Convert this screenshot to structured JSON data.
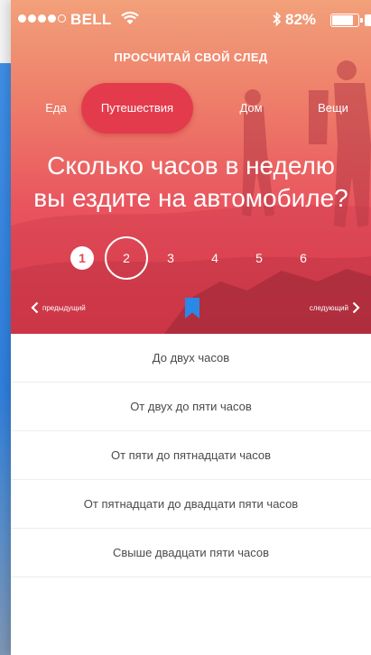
{
  "status": {
    "carrier": "BELL",
    "battery": "82%",
    "battery_level": 0.82
  },
  "header": {
    "title": "ПРОСЧИТАЙ СВОЙ СЛЕД"
  },
  "tabs": [
    {
      "label": "Еда",
      "active": false
    },
    {
      "label": "Путешествия",
      "active": true
    },
    {
      "label": "Дом",
      "active": false
    },
    {
      "label": "Вещи",
      "active": false
    }
  ],
  "question": {
    "line1": "Сколько часов в неделю",
    "line2": "вы ездите на автомобиле?"
  },
  "steps": [
    {
      "label": "1",
      "state": "done"
    },
    {
      "label": "2",
      "state": "current"
    },
    {
      "label": "3",
      "state": "upcoming"
    },
    {
      "label": "4",
      "state": "upcoming"
    },
    {
      "label": "5",
      "state": "upcoming"
    },
    {
      "label": "6",
      "state": "upcoming"
    }
  ],
  "nav": {
    "prev_label": "предыдущий",
    "next_label": "следующий"
  },
  "answers": [
    "До двух часов",
    "От двух до пяти часов",
    "От пяти до пятнадцати часов",
    "От пятнадцати до двадцати пяти часов",
    "Свыше двадцати пяти часов"
  ],
  "colors": {
    "accent": "#e43b4c",
    "bookmark": "#2a88e6",
    "background_card": "#3f8ee6"
  },
  "icons": [
    "wifi-icon",
    "bluetooth-icon",
    "battery-icon",
    "chevron-left-icon",
    "chevron-right-icon",
    "bookmark-icon"
  ]
}
